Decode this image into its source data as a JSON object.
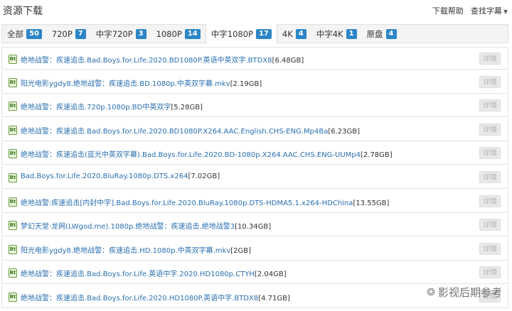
{
  "header": {
    "title": "资源下载",
    "help": "下载帮助",
    "subtitle_find": "查找字幕"
  },
  "tabs": [
    {
      "label": "全部",
      "count": "50",
      "active": false
    },
    {
      "label": "720P",
      "count": "7",
      "active": false
    },
    {
      "label": "中字720P",
      "count": "3",
      "active": false
    },
    {
      "label": "1080P",
      "count": "14",
      "active": false
    },
    {
      "label": "中字1080P",
      "count": "17",
      "active": true
    },
    {
      "label": "4K",
      "count": "4",
      "active": false
    },
    {
      "label": "中字4K",
      "count": "1",
      "active": false
    },
    {
      "label": "原盘",
      "count": "4",
      "active": false
    }
  ],
  "rows": [
    {
      "name": "绝地战警：疾速追击.Bad.Boys.for.Life.2020.BD1080P.英语中英双字.BTDX8",
      "size": "[6.48GB]",
      "detail": "详情"
    },
    {
      "name": "阳光电影ygdy8.绝地战警：疾速追击.BD.1080p.中英双字幕.mkv",
      "size": "[2.19GB]",
      "detail": "详情"
    },
    {
      "name": "绝地战警：疾速追击.720p.1080p.BD中英双字",
      "size": "[5.28GB]",
      "detail": "详情"
    },
    {
      "name": "绝地战警：疾速追击.Bad.Boys.for.Life.2020.BD1080P.X264.AAC.English.CHS-ENG.Mp4Ba",
      "size": "[6.23GB]",
      "detail": "详情"
    },
    {
      "name": "绝地战警：疾速追击(蓝光中英双字幕).Bad.Boys.for.Life.2020.BD-1080p.X264.AAC.CHS.ENG-UUMp4",
      "size": "[2.78GB]",
      "detail": "详情"
    },
    {
      "name": "Bad.Boys.for.Life.2020.BluRay.1080p.DTS.x264",
      "size": "[7.02GB]",
      "detail": "详情"
    },
    {
      "name": "绝地战警:疾速追击[内封中字].Bad.Boys.for.Life.2020.BluRay.1080p.DTS-HDMA5.1.x264-HDChina",
      "size": "[13.55GB]",
      "detail": "详情"
    },
    {
      "name": "梦幻天堂·龙网(LWgod.me).1080p.绝地战警：疾速追击.绝地战警3",
      "size": "[10.34GB]",
      "detail": "详情"
    },
    {
      "name": "阳光电影ygdy8.绝地战警：疾速追击.HD.1080p.中英双字幕.mkv",
      "size": "[2GB]",
      "detail": "详情"
    },
    {
      "name": "绝地战警：疾速追击.Bad.Boys.for.Life.英语中字.2020.HD1080p.CTYH",
      "size": "[2.04GB]",
      "detail": "详情"
    },
    {
      "name": "绝地战警：疾速追击.Bad.Boys.for.Life.2020.HD1080P.英语中字.BTDX8",
      "size": "[4.71GB]",
      "detail": "详情"
    }
  ],
  "watermark": "影视后期参考",
  "icons": {
    "file": "bt-file-icon",
    "watermark": "wechat-icon"
  },
  "colors": {
    "accent": "#2b85c6",
    "link": "#2a6fb0"
  }
}
